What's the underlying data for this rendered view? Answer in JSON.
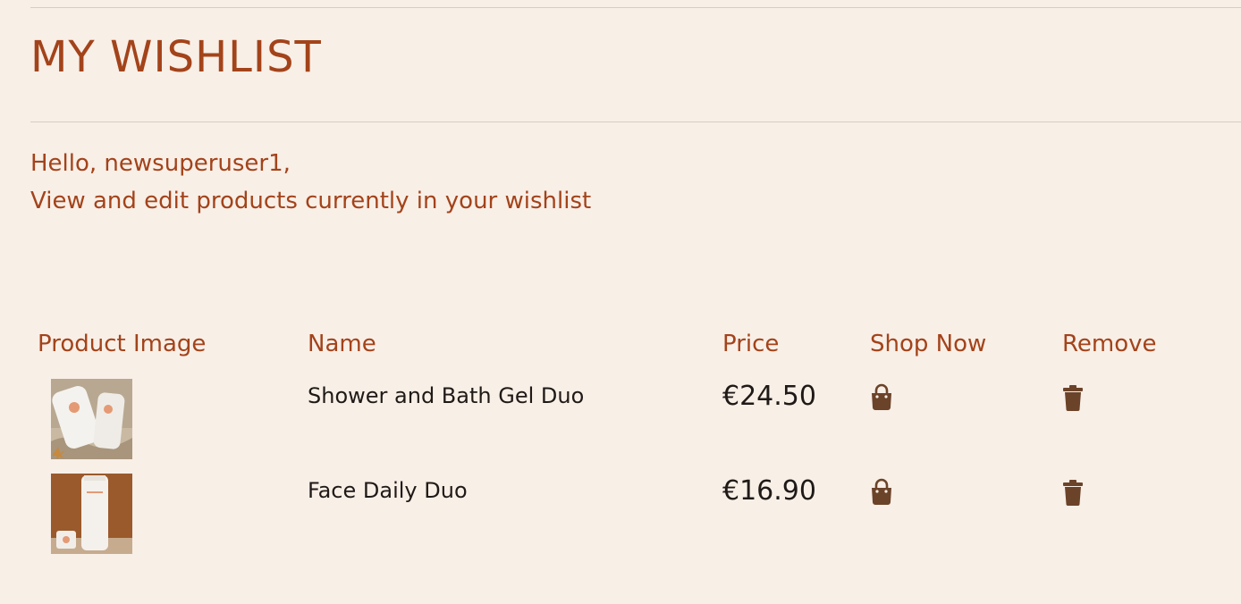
{
  "page": {
    "title": "MY WISHLIST",
    "greeting": "Hello, newsuperuser1,",
    "subtitle": "View and edit products currently in your wishlist"
  },
  "table": {
    "headers": {
      "image": "Product Image",
      "name": "Name",
      "price": "Price",
      "shop": "Shop Now",
      "remove": "Remove"
    },
    "rows": [
      {
        "name": "Shower and Bath Gel Duo",
        "price": "€24.50",
        "image_icon": "product-photo",
        "shop_icon": "shopping-bag-icon",
        "remove_icon": "trash-icon"
      },
      {
        "name": "Face Daily Duo",
        "price": "€16.90",
        "image_icon": "product-photo",
        "shop_icon": "shopping-bag-icon",
        "remove_icon": "trash-icon"
      }
    ]
  },
  "colors": {
    "background": "#f8efe7",
    "accent": "#a3431a",
    "text": "#1f1a17",
    "icon": "#6b4329",
    "divider": "#d6cdc6"
  }
}
